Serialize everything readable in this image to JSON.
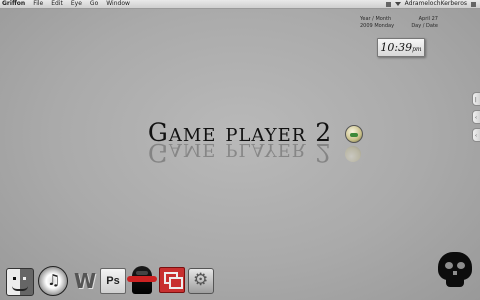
{
  "menubar": {
    "app_name": "Griffon",
    "menus": [
      "File",
      "Edit",
      "Eye",
      "Go",
      "Window"
    ],
    "user": "AdramelochKerberos"
  },
  "date_widget": {
    "left_top": "Year / Month",
    "right_top": "April 27",
    "left_bottom": "2009 Monday",
    "right_bottom": "Day / Date"
  },
  "clock": {
    "time": "10:39",
    "ampm": "pm"
  },
  "title": "Game player 2",
  "dock": {
    "items": [
      {
        "name": "Finder",
        "icon": "finder-icon"
      },
      {
        "name": "iTunes",
        "icon": "itunes-icon"
      },
      {
        "name": "W",
        "icon": "w-logo-icon",
        "label": "W"
      },
      {
        "name": "Photoshop",
        "icon": "photoshop-icon",
        "label": "Ps"
      },
      {
        "name": "Vader",
        "icon": "vader-icon"
      },
      {
        "name": "Screen Sharing",
        "icon": "screens-icon"
      },
      {
        "name": "System Preferences",
        "icon": "system-preferences-icon"
      }
    ]
  },
  "right_edge_tabs": [
    "|",
    "‹",
    "‹"
  ]
}
